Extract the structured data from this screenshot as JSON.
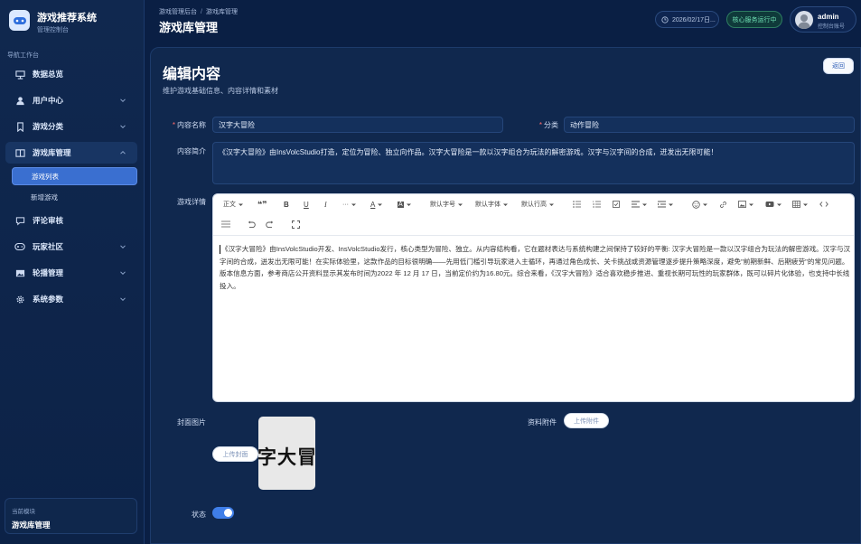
{
  "app": {
    "title": "游戏推荐系统",
    "subtitle": "管理控制台"
  },
  "sidebar": {
    "header": "导航工作台",
    "items": [
      {
        "label": "数据总览",
        "icon": "presentation-icon"
      },
      {
        "label": "用户中心",
        "icon": "user-icon"
      },
      {
        "label": "游戏分类",
        "icon": "bookmark-icon"
      },
      {
        "label": "游戏库管理",
        "icon": "book-icon",
        "expanded": true,
        "children": [
          {
            "label": "游戏列表",
            "active": true
          },
          {
            "label": "新增游戏"
          }
        ]
      },
      {
        "label": "评论审核",
        "icon": "chat-icon"
      },
      {
        "label": "玩家社区",
        "icon": "gamepad-icon"
      },
      {
        "label": "轮播管理",
        "icon": "image-icon"
      },
      {
        "label": "系统参数",
        "icon": "gear-icon"
      }
    ],
    "module": {
      "label": "当前模块",
      "value": "游戏库管理"
    }
  },
  "topbar": {
    "breadcrumb": [
      "游戏管理后台",
      "游戏库管理"
    ],
    "title": "游戏库管理",
    "date": "2026/02/17日...",
    "status": "核心服务运行中",
    "user": {
      "name": "admin",
      "role": "控制台账号"
    }
  },
  "form": {
    "title": "编辑内容",
    "subtitle": "维护游戏基础信息、内容详情和素材",
    "back_label": "返回",
    "name_label": "内容名称",
    "name_value": "汉字大冒险",
    "category_label": "分类",
    "category_value": "动作冒险",
    "intro_label": "内容简介",
    "intro_value": "《汉字大冒险》由InsVolcStudio打造，定位为冒险、独立向作品。汉字大冒险是一款以汉字组合为玩法的解密游戏。汉字与汉字间的合成，迸发出无限可能！",
    "detail_label": "游戏详情",
    "detail_value": "《汉字大冒险》由InsVolcStudio开发、InsVolcStudio发行，核心类型为冒险、独立。从内容结构看，它在题材表达与系统构建之间保持了较好的平衡: 汉字大冒险是一款以汉字组合为玩法的解密游戏。汉字与汉字间的合成，迸发出无限可能！在实际体验里，这款作品的目标很明确——先用低门槛引导玩家进入主循环，再通过角色成长、关卡挑战或资源管理逐步提升策略深度，避免\"前期新鲜、后期疲劳\"的常见问题。版本信息方面，参考商店公开资料显示其发布时间为2022 年 12 月 17 日，当前定价约为16.80元。综合来看，《汉字大冒险》适合喜欢稳步推进、重视长期可玩性的玩家群体，既可以碎片化体验，也支持中长线投入。",
    "cover_label": "封面图片",
    "cover_upload": "上传封面",
    "cover_text": "字大冒",
    "attachment_label": "资料附件",
    "attachment_upload": "上传附件",
    "status_label": "状态",
    "status_on": true
  },
  "toolbar": {
    "body": "正文",
    "quote": "❝❞",
    "bold": "B",
    "underline": "U",
    "italic": "I",
    "more": "···",
    "font_color": "A",
    "bg_color": "A",
    "font_size": "默认字号",
    "font_family": "默认字体",
    "line_height": "默认行高"
  }
}
